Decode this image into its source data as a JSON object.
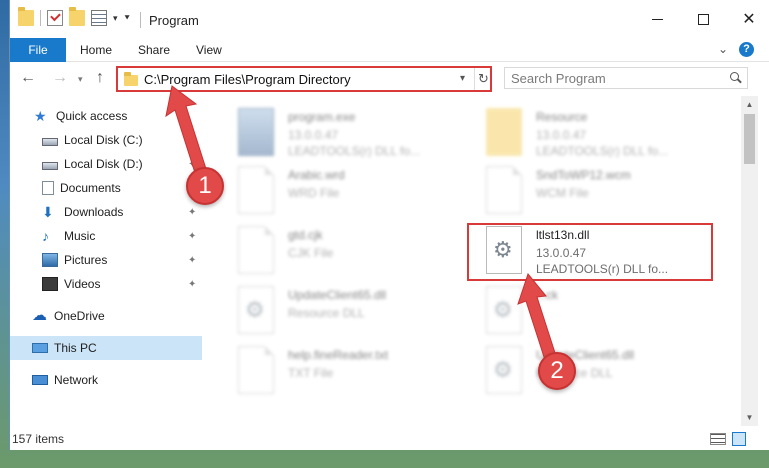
{
  "window": {
    "title": "Program"
  },
  "ribbon": {
    "tabs": [
      {
        "label": "File"
      },
      {
        "label": "Home"
      },
      {
        "label": "Share"
      },
      {
        "label": "View"
      }
    ]
  },
  "nav": {
    "address": "C:\\Program Files\\Program Directory",
    "search_placeholder": "Search Program"
  },
  "sidebar": {
    "items": [
      {
        "label": "Quick access",
        "icon": "star-icon"
      },
      {
        "label": "Local Disk (C:)",
        "icon": "drive-icon"
      },
      {
        "label": "Local Disk (D:)",
        "icon": "drive-icon"
      },
      {
        "label": "Documents",
        "icon": "documents-icon"
      },
      {
        "label": "Downloads",
        "icon": "download-icon"
      },
      {
        "label": "Music",
        "icon": "music-icon"
      },
      {
        "label": "Pictures",
        "icon": "pictures-icon"
      },
      {
        "label": "Videos",
        "icon": "videos-icon"
      },
      {
        "label": "OneDrive",
        "icon": "cloud-icon"
      },
      {
        "label": "This PC",
        "icon": "computer-icon",
        "selected": true
      },
      {
        "label": "Network",
        "icon": "network-icon"
      }
    ]
  },
  "files": [
    {
      "name": "program.exe",
      "line2": "13.0.0.47",
      "line3": "LEADTOOLS(r) DLL fo...",
      "blurred": true
    },
    {
      "name": "Resource",
      "line2": "13.0.0.47",
      "line3": "LEADTOOLS(r) DLL fo...",
      "blurred": true
    },
    {
      "name": "Arabic.wrd",
      "line2": "WRD File",
      "blurred": true
    },
    {
      "name": "SndToWP12.wcm",
      "line2": "WCM File",
      "blurred": true
    },
    {
      "name": "gtd.cjk",
      "line2": "CJK File",
      "blurred": true
    },
    {
      "name": "ltlst13n.dll",
      "line2": "13.0.0.47",
      "line3": "LEADTOOLS(r) DLL fo...",
      "blurred": false
    },
    {
      "name": "UpdateClient65.dll",
      "line2": "Resource DLL",
      "blurred": true
    },
    {
      "name": "...ck",
      "line2": "",
      "blurred": true
    },
    {
      "name": "help.fineReader.txt",
      "line2": "TXT File",
      "blurred": true
    },
    {
      "name": "UpdateClient65.dll",
      "line2": "Resource DLL",
      "blurred": true
    }
  ],
  "status": {
    "item_count": "157 items"
  },
  "annotations": {
    "badge_1": "1",
    "badge_2": "2"
  },
  "colors": {
    "accent": "#1979ca",
    "highlight_red": "#d83a3a",
    "selected_bg": "#cce4f7"
  }
}
